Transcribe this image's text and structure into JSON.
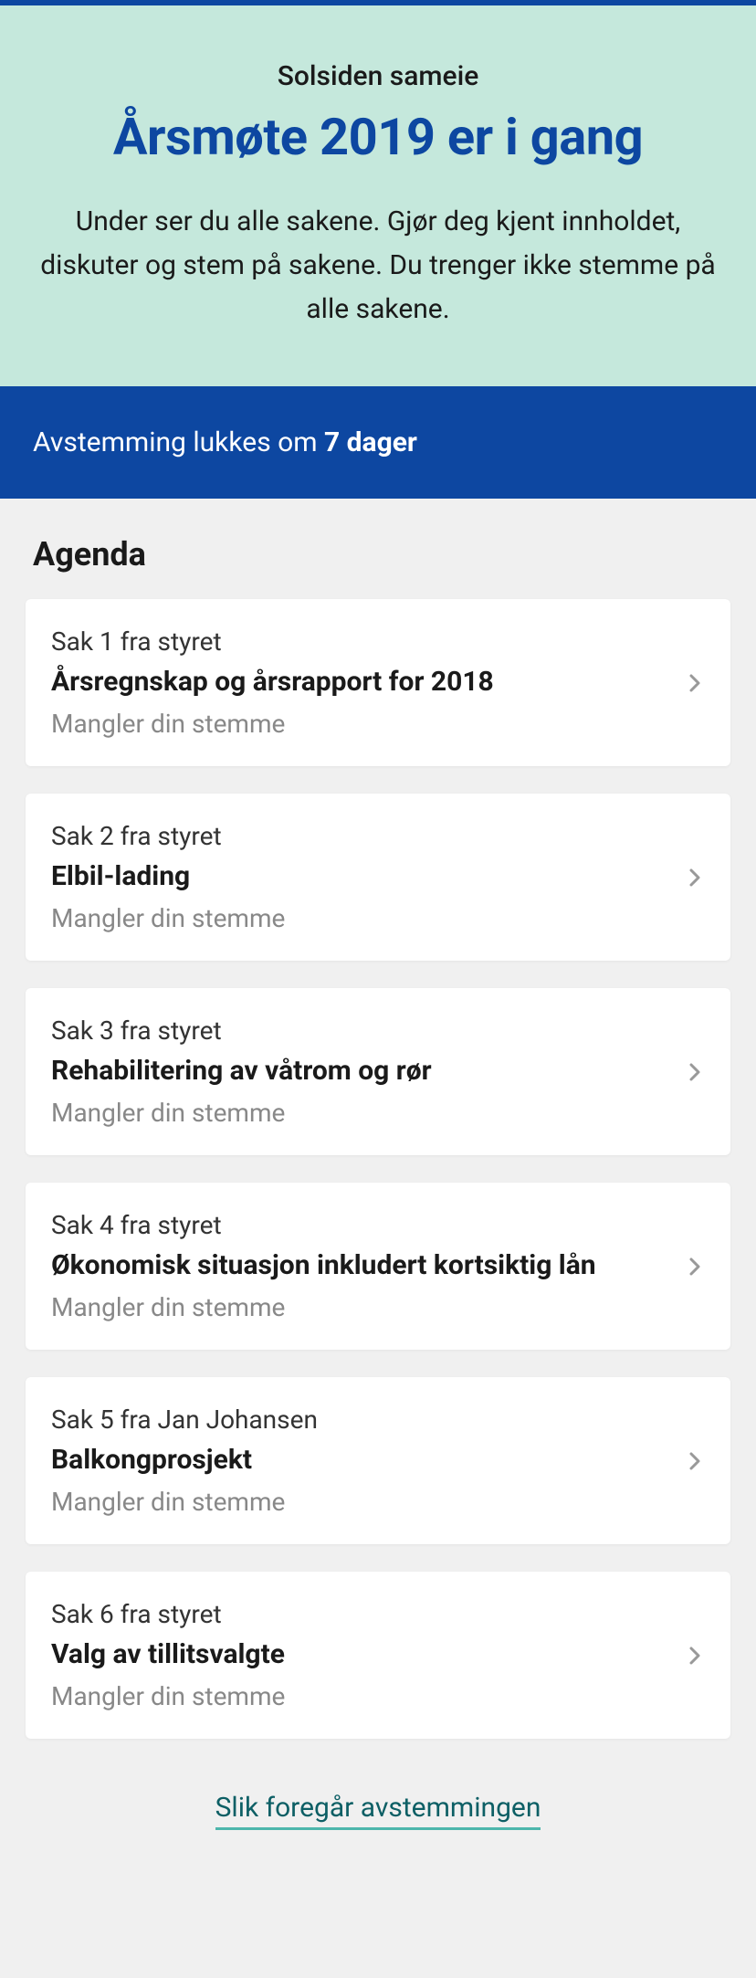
{
  "header": {
    "subtitle": "Solsiden sameie",
    "title": "Årsmøte 2019 er i gang",
    "description": "Under ser du alle sakene. Gjør deg kjent innholdet,  diskuter og stem på sakene. Du trenger ikke stemme på alle sakene."
  },
  "voting_banner": {
    "prefix": "Avstemming lukkes om ",
    "duration": "7 dager"
  },
  "agenda": {
    "title": "Agenda",
    "items": [
      {
        "label": "Sak 1 fra styret",
        "title": "Årsregnskap og årsrapport for 2018",
        "status": "Mangler din stemme"
      },
      {
        "label": "Sak 2 fra styret",
        "title": "Elbil-lading",
        "status": "Mangler din stemme"
      },
      {
        "label": "Sak 3 fra styret",
        "title": "Rehabilitering av våtrom og rør",
        "status": "Mangler din stemme"
      },
      {
        "label": "Sak 4 fra styret",
        "title": "Økonomisk situasjon inkludert kortsiktig lån",
        "status": "Mangler din stemme"
      },
      {
        "label": "Sak 5 fra Jan Johansen",
        "title": "Balkongprosjekt",
        "status": "Mangler din stemme"
      },
      {
        "label": "Sak 6 fra styret",
        "title": "Valg av tillitsvalgte",
        "status": "Mangler din stemme"
      }
    ]
  },
  "footer": {
    "link_text": "Slik foregår avstemmingen"
  }
}
